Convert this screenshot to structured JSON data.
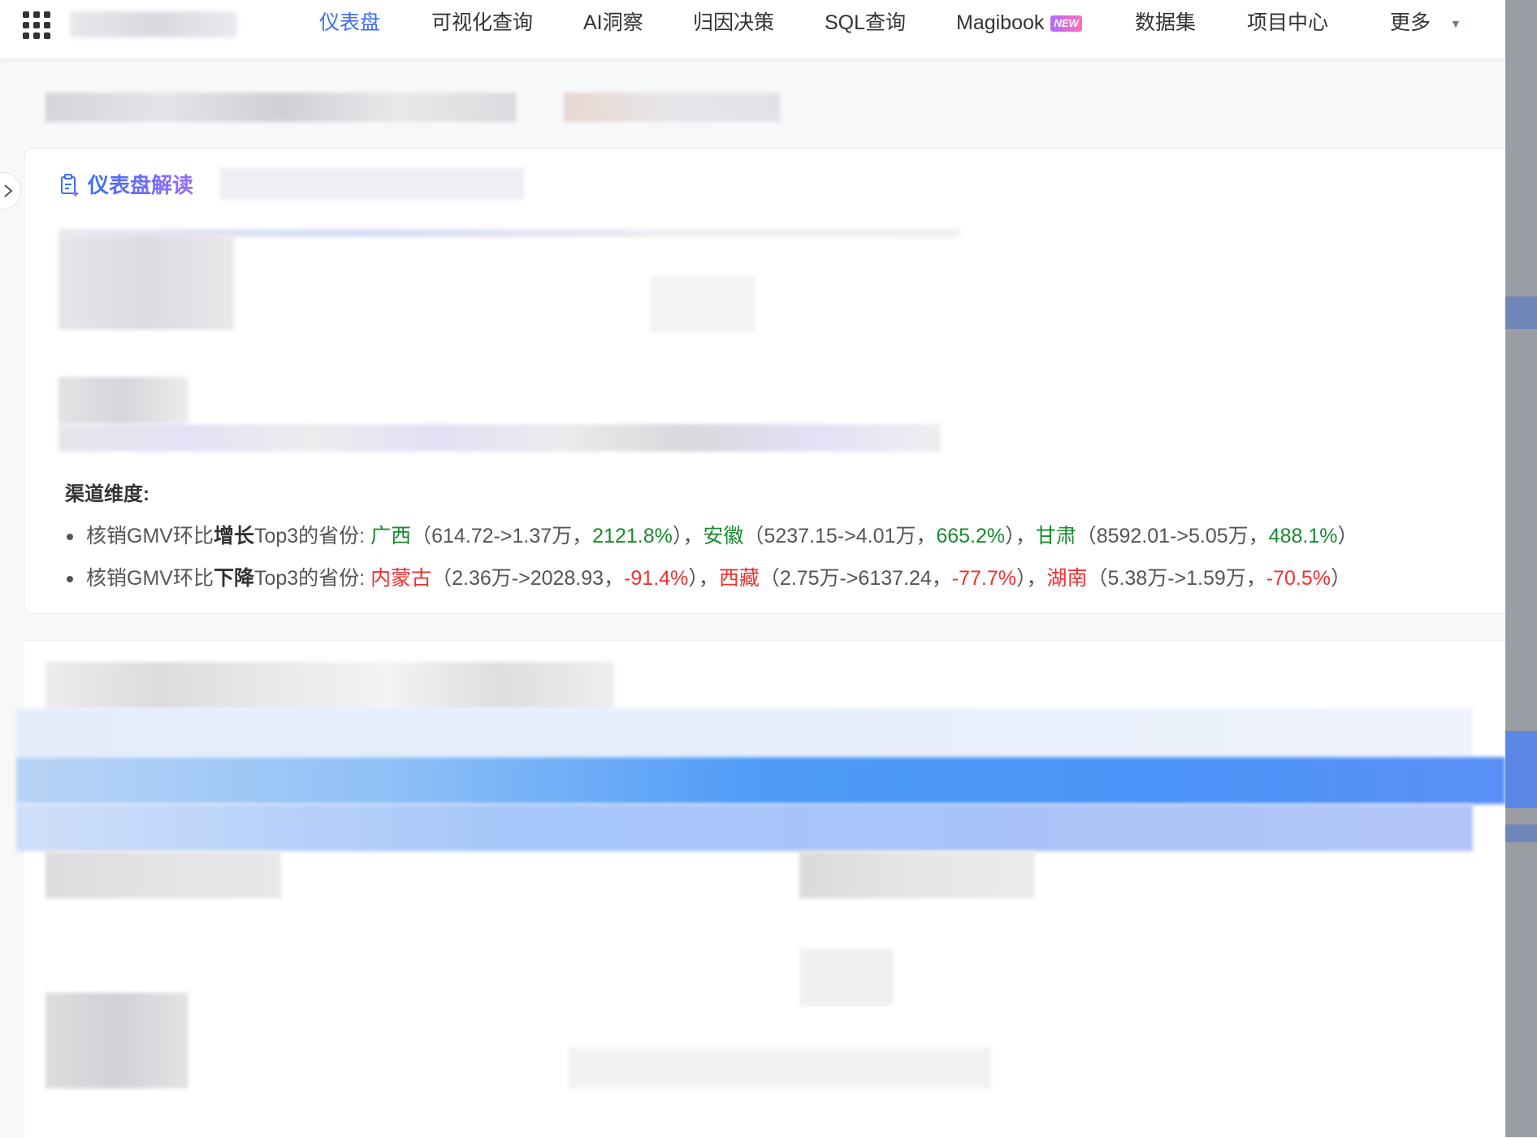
{
  "nav": {
    "items": [
      "仪表盘",
      "可视化查询",
      "AI洞察",
      "归因决策",
      "SQL查询",
      "Magibook",
      "数据集",
      "项目中心",
      "更多"
    ],
    "active_index": 0,
    "new_badge": "NEW"
  },
  "insight": {
    "title": "仪表盘解读",
    "section_label": "渠道维度:",
    "rows": [
      {
        "prefix": "核销GMV环比",
        "keyword": "增长",
        "suffix": "Top3的省份:",
        "entries": [
          {
            "name": "广西",
            "detail": "（614.72->1.37万，",
            "pct": "2121.8%",
            "close": "）"
          },
          {
            "name": "安徽",
            "detail": "（5237.15->4.01万，",
            "pct": "665.2%",
            "close": "）"
          },
          {
            "name": "甘肃",
            "detail": "（8592.01->5.05万，",
            "pct": "488.1%",
            "close": "）"
          }
        ]
      },
      {
        "prefix": "核销GMV环比",
        "keyword": "下降",
        "suffix": "Top3的省份:",
        "entries": [
          {
            "name": "内蒙古",
            "detail": "（2.36万->2028.93，",
            "pct": "-91.4%",
            "close": "）"
          },
          {
            "name": "西藏",
            "detail": "（2.75万->6137.24，",
            "pct": "-77.7%",
            "close": "）"
          },
          {
            "name": "湖南",
            "detail": "（5.38万->1.59万，",
            "pct": "-70.5%",
            "close": "）"
          }
        ]
      }
    ],
    "separator": "，"
  },
  "colors": {
    "accent": "#3b6ef5",
    "increase": "#1a8a2e",
    "decrease": "#f23030"
  }
}
